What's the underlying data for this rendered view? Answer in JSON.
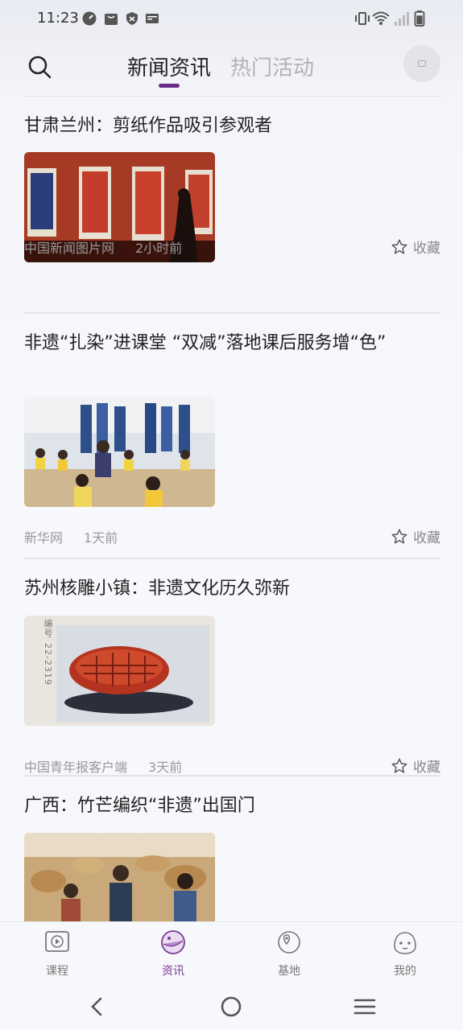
{
  "status_bar": {
    "time": "11:23"
  },
  "header": {
    "tabs": [
      {
        "label": "新闻资讯",
        "active": true
      },
      {
        "label": "热门活动",
        "active": false
      }
    ],
    "accent_color": "#6a2b8a"
  },
  "articles": [
    {
      "title": "甘肃兰州：剪纸作品吸引参观者",
      "source": "中国新闻图片网",
      "time": "2小时前",
      "fav_label": "收藏",
      "image_icon": "papercut-exhibition-photo"
    },
    {
      "title": "非遗“扎染”进课堂 “双减”落地课后服务增“色”",
      "source": "新华网",
      "time": "1天前",
      "fav_label": "收藏",
      "image_icon": "classroom-tie-dye-photo"
    },
    {
      "title": "苏州核雕小镇：非遗文化历久弥新",
      "source": "中国青年报客户端",
      "time": "3天前",
      "fav_label": "收藏",
      "image_icon": "walnut-carving-photo",
      "image_text": [
        "编号",
        "22-2319"
      ]
    },
    {
      "title": "广西：竹芒编织“非遗”出国门",
      "image_icon": "bamboo-weaving-photo"
    }
  ],
  "bottom_nav": {
    "items": [
      {
        "label": "课程",
        "icon": "play-icon",
        "active": false
      },
      {
        "label": "资讯",
        "icon": "news-icon",
        "active": true
      },
      {
        "label": "基地",
        "icon": "location-icon",
        "active": false
      },
      {
        "label": "我的",
        "icon": "profile-icon",
        "active": false
      }
    ]
  }
}
